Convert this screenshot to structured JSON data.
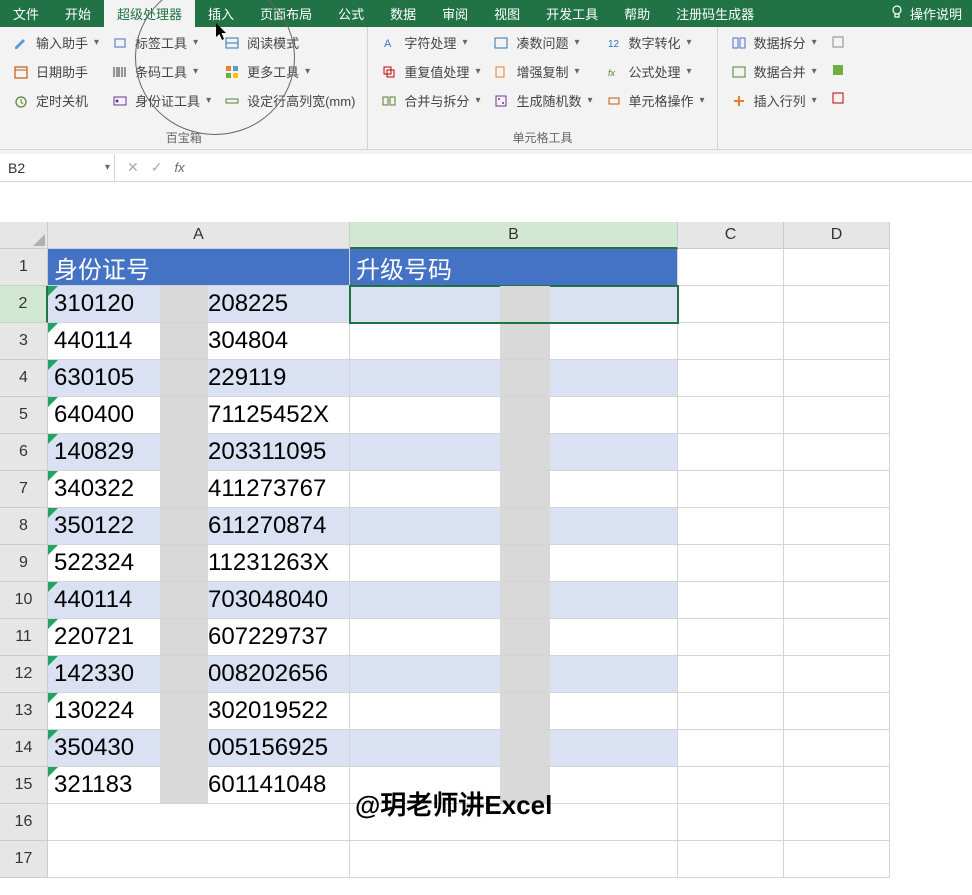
{
  "tabs": {
    "file": "文件",
    "home": "开始",
    "super": "超级处理器",
    "insert": "插入",
    "layout": "页面布局",
    "formula": "公式",
    "data": "数据",
    "review": "审阅",
    "view": "视图",
    "dev": "开发工具",
    "help": "帮助",
    "reg": "注册码生成器",
    "tellme": "操作说明"
  },
  "ribbon": {
    "group1_label": "百宝箱",
    "group2_label": "单元格工具",
    "input_helper": "输入助手",
    "date_helper": "日期助手",
    "timer_off": "定时关机",
    "tag_tool": "标签工具",
    "barcode_tool": "条码工具",
    "id_tool": "身份证工具",
    "read_mode": "阅读模式",
    "more_tools": "更多工具",
    "set_rowcol": "设定行高列宽(mm)",
    "char_proc": "字符处理",
    "dup_proc": "重复值处理",
    "merge_split": "合并与拆分",
    "collect_q": "凑数问题",
    "enhance_copy": "增强复制",
    "gen_random": "生成随机数",
    "num_convert": "数字转化",
    "formula_proc": "公式处理",
    "cell_ops": "单元格操作",
    "data_split": "数据拆分",
    "data_merge": "数据合并",
    "insert_rowcol": "插入行列"
  },
  "namebox": "B2",
  "columns": [
    "A",
    "B",
    "C",
    "D"
  ],
  "headers": {
    "a": "身份证号",
    "b": "升级号码"
  },
  "rows": [
    {
      "n": 1
    },
    {
      "n": 2,
      "a_pre": "310120",
      "a_post": "208225"
    },
    {
      "n": 3,
      "a_pre": "440114",
      "a_post": "304804"
    },
    {
      "n": 4,
      "a_pre": "630105",
      "a_post": "229119"
    },
    {
      "n": 5,
      "a_pre": "640400",
      "a_post": "71125452X"
    },
    {
      "n": 6,
      "a_pre": "140829",
      "a_post": "203311095"
    },
    {
      "n": 7,
      "a_pre": "340322",
      "a_post": "411273767"
    },
    {
      "n": 8,
      "a_pre": "350122",
      "a_post": "611270874"
    },
    {
      "n": 9,
      "a_pre": "522324",
      "a_post": "11231263X"
    },
    {
      "n": 10,
      "a_pre": "440114",
      "a_post": "703048040"
    },
    {
      "n": 11,
      "a_pre": "220721",
      "a_post": "607229737"
    },
    {
      "n": 12,
      "a_pre": "142330",
      "a_post": "008202656"
    },
    {
      "n": 13,
      "a_pre": "130224",
      "a_post": "302019522"
    },
    {
      "n": 14,
      "a_pre": "350430",
      "a_post": "005156925"
    },
    {
      "n": 15,
      "a_pre": "321183",
      "a_post": "601141048"
    },
    {
      "n": 16
    },
    {
      "n": 17
    }
  ],
  "watermark": "@玥老师讲Excel"
}
